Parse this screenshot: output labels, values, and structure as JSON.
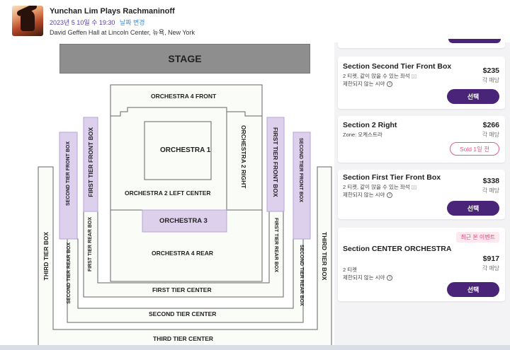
{
  "event": {
    "title": "Yunchan Lim Plays Rachmaninoff",
    "date": "2023년 5 10일 수 19:30",
    "date_change_label": "날짜 변경",
    "venue": "David Geffen Hall at Lincoln Center, 뉴욕, New York"
  },
  "map": {
    "stage": "STAGE",
    "sections": {
      "orchestra_4_front": "ORCHESTRA 4 FRONT",
      "orchestra_1": "ORCHESTRA 1",
      "orchestra_2_right": "ORCHESTRA 2 RIGHT",
      "orchestra_2_left_center": "ORCHESTRA 2 LEFT CENTER",
      "orchestra_3": "ORCHESTRA 3",
      "orchestra_4_rear": "ORCHESTRA 4 REAR",
      "first_tier_center": "FIRST TIER CENTER",
      "second_tier_center": "SECOND TIER CENTER",
      "third_tier_center": "THIRD TIER CENTER",
      "first_tier_front_box": "FIRST TIER FRONT BOX",
      "second_tier_front_box": "SECOND TIER FRONT BOX",
      "first_tier_rear_box": "FIRST TIER REAR BOX",
      "second_tier_rear_box": "SECOND TIER REAR BOX",
      "third_tier_box": "THIRD TIER BOX"
    },
    "colors": {
      "highlight": "#ddd0ec",
      "highlight_border": "#b9a3d6",
      "section_fill": "#fafcf8",
      "section_border": "#666666"
    }
  },
  "listings": [
    {
      "section": "Section Second Tier Front Box",
      "price": "$235",
      "per": "각 매당",
      "tickets": "2 티켓, 같이 앉을 수 있는 좌석",
      "view": "제한되지 않는 시야",
      "action": "선택"
    },
    {
      "section": "Section 2 Right",
      "price": "$266",
      "per": "각 매당",
      "zone": "Zone: 오케스트라",
      "sold": "Sold 1일 전"
    },
    {
      "section": "Section First Tier Front Box",
      "price": "$338",
      "per": "각 매당",
      "tickets": "2 티켓, 같이 앉을 수 있는 좌석",
      "view": "제한되지 않는 시야",
      "action": "선택"
    },
    {
      "section": "Section CENTER ORCHESTRA",
      "badge": "최근 본 이벤트",
      "price": "$917",
      "per": "각 매당",
      "tickets": "2 티켓",
      "view": "제한되지 않는 시야",
      "action": "선택"
    }
  ]
}
